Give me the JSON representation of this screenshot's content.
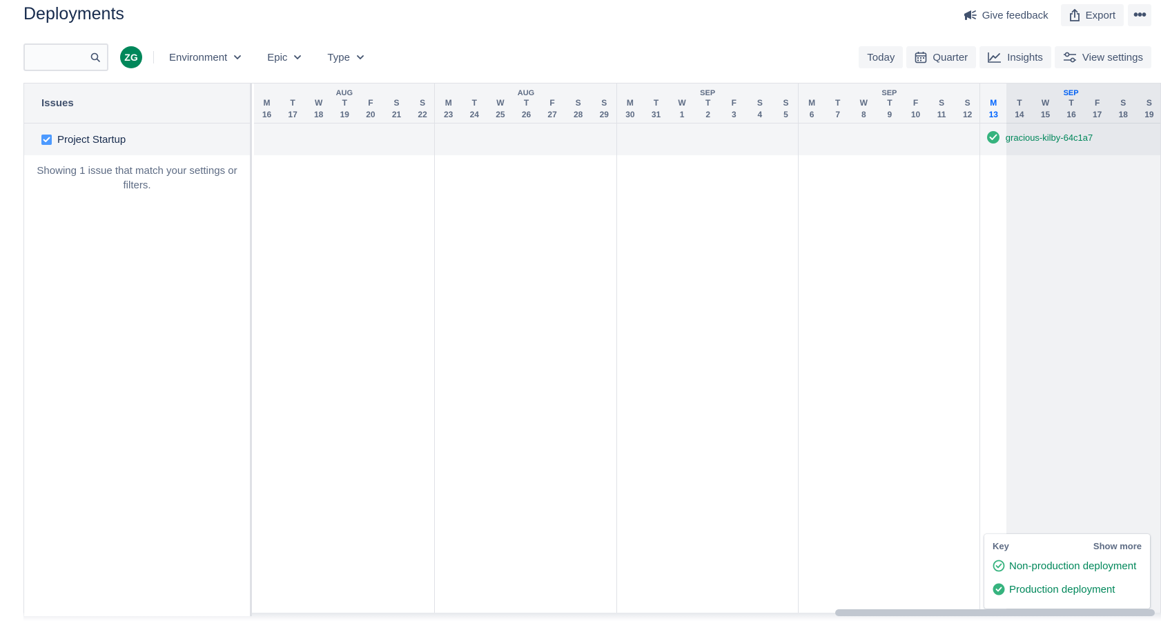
{
  "page": {
    "title": "Deployments"
  },
  "top_actions": {
    "feedback_label": "Give feedback",
    "export_label": "Export",
    "more_label": "•••"
  },
  "filters": {
    "search_placeholder": "",
    "avatar_initials": "ZG",
    "environment_label": "Environment",
    "epic_label": "Epic",
    "type_label": "Type"
  },
  "view_controls": {
    "today_label": "Today",
    "quarter_label": "Quarter",
    "insights_label": "Insights",
    "view_settings_label": "View settings"
  },
  "issues": {
    "header": "Issues",
    "rows": [
      {
        "label": "Project Startup",
        "checked": true
      }
    ],
    "showing_text": "Showing 1 issue that match your settings or filters."
  },
  "timeline": {
    "weeks": [
      {
        "month": "AUG",
        "days": [
          {
            "d": "M",
            "n": "16"
          },
          {
            "d": "T",
            "n": "17"
          },
          {
            "d": "W",
            "n": "18"
          },
          {
            "d": "T",
            "n": "19"
          },
          {
            "d": "F",
            "n": "20"
          },
          {
            "d": "S",
            "n": "21"
          },
          {
            "d": "S",
            "n": "22"
          }
        ]
      },
      {
        "month": "AUG",
        "days": [
          {
            "d": "M",
            "n": "23"
          },
          {
            "d": "T",
            "n": "24"
          },
          {
            "d": "W",
            "n": "25"
          },
          {
            "d": "T",
            "n": "26"
          },
          {
            "d": "F",
            "n": "27"
          },
          {
            "d": "S",
            "n": "28"
          },
          {
            "d": "S",
            "n": "29"
          }
        ]
      },
      {
        "month": "SEP",
        "days": [
          {
            "d": "M",
            "n": "30"
          },
          {
            "d": "T",
            "n": "31"
          },
          {
            "d": "W",
            "n": "1"
          },
          {
            "d": "T",
            "n": "2"
          },
          {
            "d": "F",
            "n": "3"
          },
          {
            "d": "S",
            "n": "4"
          },
          {
            "d": "S",
            "n": "5"
          }
        ]
      },
      {
        "month": "SEP",
        "days": [
          {
            "d": "M",
            "n": "6"
          },
          {
            "d": "T",
            "n": "7"
          },
          {
            "d": "W",
            "n": "8"
          },
          {
            "d": "T",
            "n": "9"
          },
          {
            "d": "F",
            "n": "10"
          },
          {
            "d": "S",
            "n": "11"
          },
          {
            "d": "S",
            "n": "12"
          }
        ]
      },
      {
        "month": "SEP",
        "days": [
          {
            "d": "M",
            "n": "13"
          },
          {
            "d": "T",
            "n": "14"
          },
          {
            "d": "W",
            "n": "15"
          },
          {
            "d": "T",
            "n": "16"
          },
          {
            "d": "F",
            "n": "17"
          },
          {
            "d": "S",
            "n": "18"
          },
          {
            "d": "S",
            "n": "19"
          }
        ]
      }
    ],
    "today": "M 13",
    "deployment": {
      "name": "gracious-kilby-64c1a7",
      "type": "production",
      "day": "M 13"
    }
  },
  "key": {
    "title": "Key",
    "show_more": "Show more",
    "items": [
      {
        "label": "Non-production deployment",
        "icon": "check-circle-outline-icon"
      },
      {
        "label": "Production deployment",
        "icon": "check-circle-filled-icon"
      }
    ]
  },
  "colors": {
    "accent": "#0065ff",
    "success": "#00875a",
    "success_icon": "#36b37e",
    "avatar": "#00875a"
  }
}
